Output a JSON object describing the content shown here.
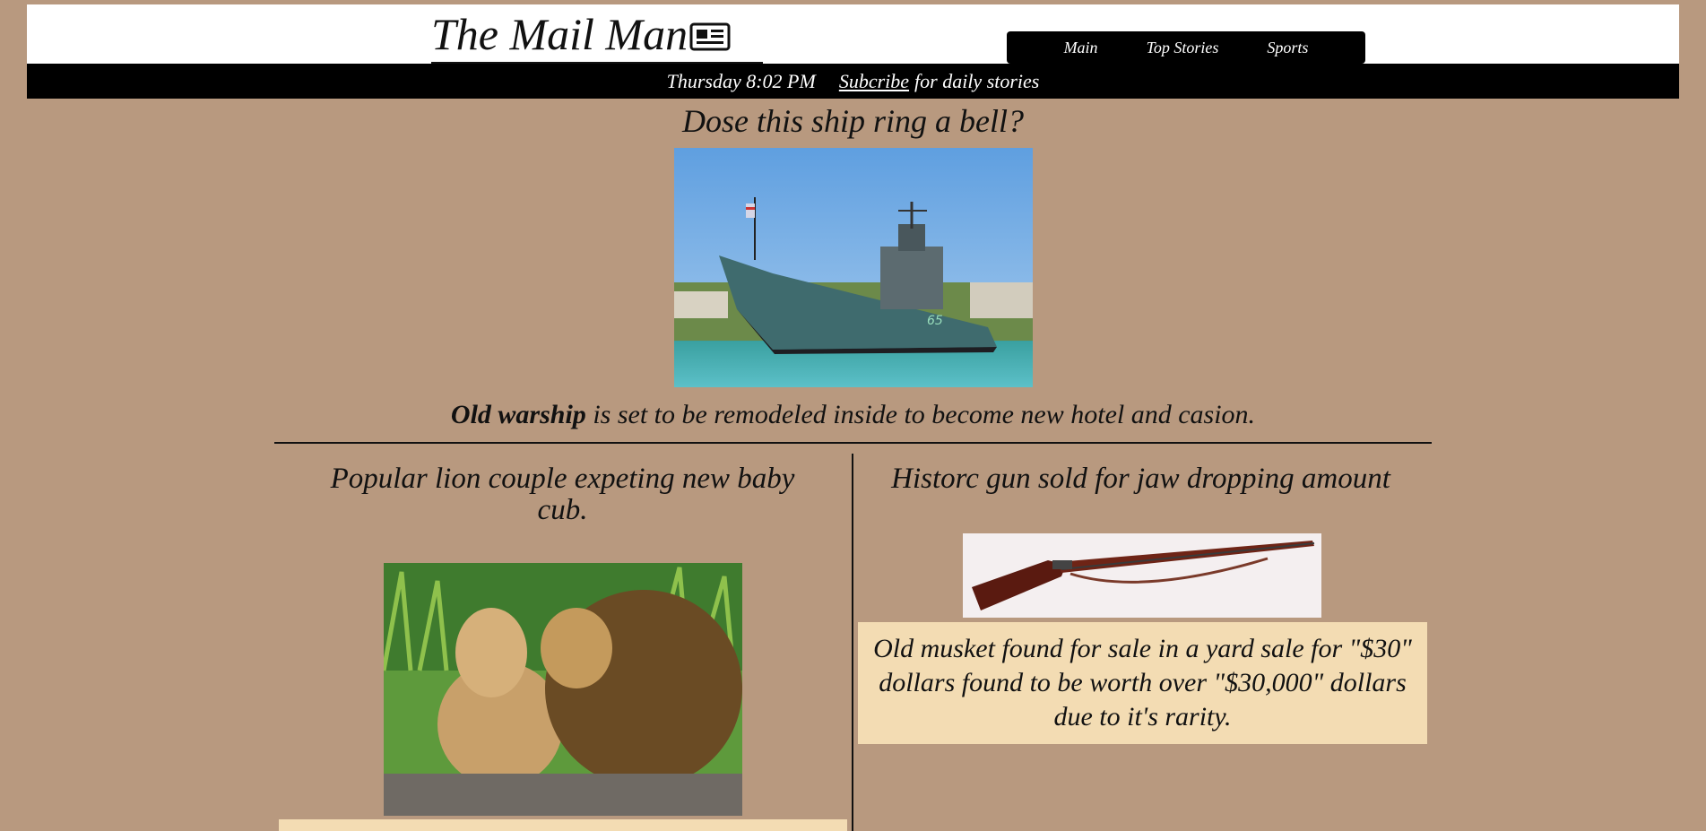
{
  "site": {
    "title": "The Mail Man",
    "logo_icon": "newspaper-icon"
  },
  "nav": {
    "items": [
      {
        "label": "Main"
      },
      {
        "label": "Top Stories"
      },
      {
        "label": "Sports"
      }
    ]
  },
  "subbar": {
    "time": "Thursday 8:02 PM",
    "subscribe_link": "Subcribe",
    "subscribe_rest": "for daily stories"
  },
  "main_story": {
    "headline": "Dose this ship ring a bell?",
    "image": "warship-photo",
    "caption_bold": "Old warship",
    "caption_rest": " is set to be remodeled inside to become new hotel and casion."
  },
  "left_story": {
    "headline": "Popular lion couple expeting new baby cub.",
    "image": "lion-couple-photo"
  },
  "right_story": {
    "headline": "Historc gun sold for jaw dropping amount",
    "image": "musket-photo",
    "caption": "Old musket found for sale in a yard sale for \"$30\" dollars found to be worth over \"$30,000\" dollars due to it's rarity."
  },
  "colors": {
    "background": "#b8997f",
    "caption_box": "#f3dcb3",
    "header": "#ffffff",
    "bar": "#000000"
  }
}
